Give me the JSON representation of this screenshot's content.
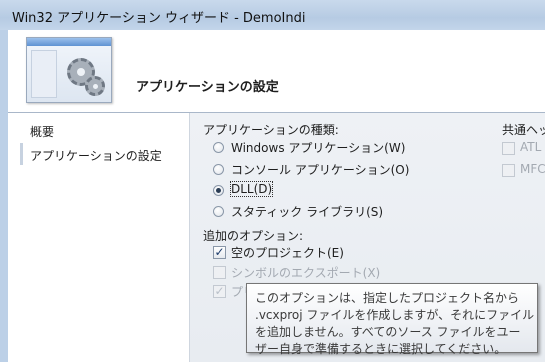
{
  "window": {
    "title": "Win32 アプリケーション ウィザード - DemoIndi"
  },
  "header": {
    "title": "アプリケーションの設定"
  },
  "nav": {
    "items": [
      {
        "label": "概要"
      },
      {
        "label": "アプリケーションの設定"
      }
    ]
  },
  "app_type": {
    "label": "アプリケーションの種類:",
    "options": [
      {
        "label": "Windows アプリケーション(W)",
        "selected": false
      },
      {
        "label": "コンソール アプリケーション(O)",
        "selected": false
      },
      {
        "label": "DLL(D)",
        "selected": true
      },
      {
        "label": "スタティック ライブラリ(S)",
        "selected": false
      }
    ]
  },
  "additional": {
    "label": "追加のオプション:",
    "options": [
      {
        "label": "空のプロジェクト(E)",
        "checked": true,
        "enabled": true
      },
      {
        "label": "シンボルのエクスポート(X)",
        "checked": false,
        "enabled": false
      },
      {
        "label": "プリ",
        "checked": true,
        "enabled": false
      }
    ]
  },
  "common_headers": {
    "label": "共通ヘッダ",
    "options": [
      {
        "label": "ATL",
        "checked": false,
        "enabled": false
      },
      {
        "label": "MFC",
        "checked": false,
        "enabled": false
      }
    ]
  },
  "tooltip": {
    "lines": [
      "このオプションは、指定したプロジェクト名から",
      ".vcxproj ファイルを作成しますが、それにファイル",
      "を追加しません。すべてのソース ファイルをユー",
      "ザー自身で準備するときに選択してください。"
    ]
  }
}
